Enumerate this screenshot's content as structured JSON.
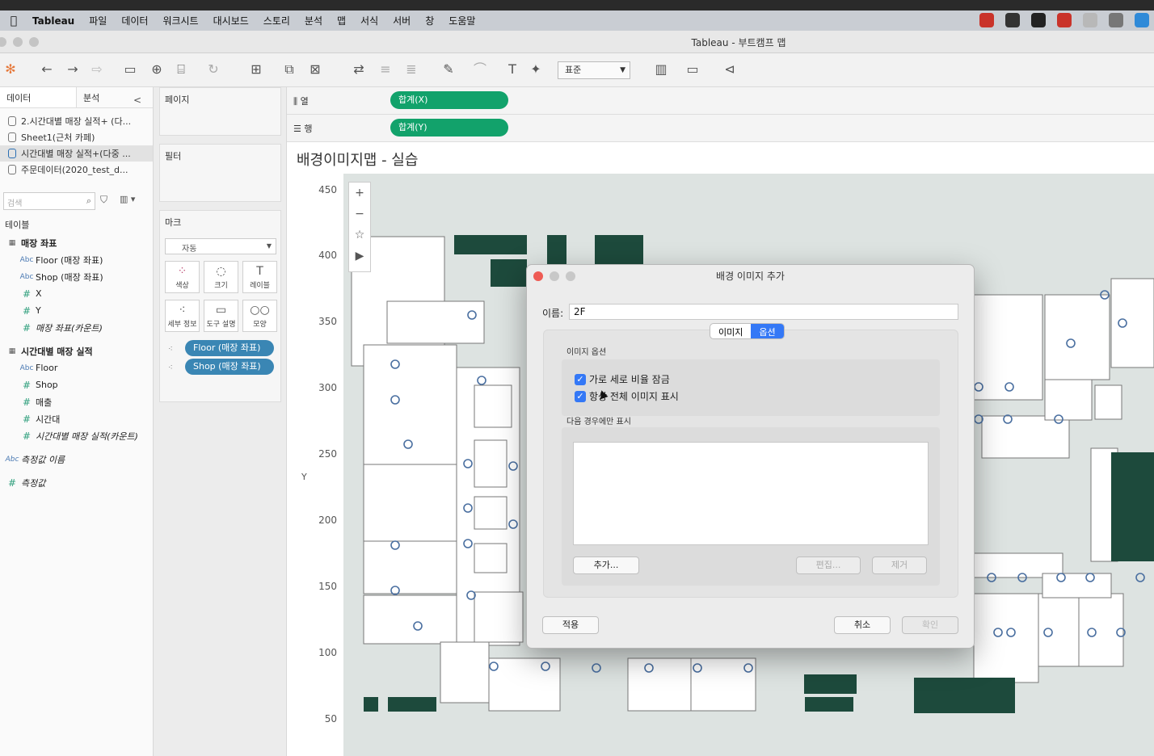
{
  "menubar": {
    "apple": "",
    "app": "Tableau",
    "items": [
      "파일",
      "데이터",
      "워크시트",
      "대시보드",
      "스토리",
      "분석",
      "맵",
      "서식",
      "서버",
      "창",
      "도움말"
    ],
    "tray_colors": [
      "#c9332a",
      "#333333",
      "#222222",
      "#c9332a",
      "#b8b8b8",
      "#777777",
      "#2f8ad8"
    ]
  },
  "window": {
    "title": "Tableau - 부트캠프 맵"
  },
  "toolbar": {
    "icons": [
      "tableau-logo-icon",
      "back-icon",
      "forward-icon",
      "redo-icon",
      "save-icon",
      "add-datasource-icon",
      "datasource-icon",
      "refresh-icon",
      "new-sheet-icon",
      "duplicate-sheet-icon",
      "clear-sheet-icon",
      "swap-icon",
      "sort-asc-icon",
      "sort-desc-icon",
      "highlight-icon",
      "group-icon",
      "label-icon",
      "pin-icon",
      "show-me-icon",
      "presentation-icon",
      "share-icon"
    ],
    "fit_value": "표준"
  },
  "datapane": {
    "tab_data": "데이터",
    "tab_analysis": "분석",
    "collapse": "<",
    "sources": [
      {
        "label": "2.시간대별 매장 실적+ (다..."
      },
      {
        "label": "Sheet1(근처 카페)"
      },
      {
        "label": "시간대별 매장 실적+(다중 ..."
      },
      {
        "label": "주문데이터(2020_test_d..."
      }
    ],
    "search_placeholder": "검색",
    "tables_label": "테이블",
    "fields": [
      {
        "type": "grp",
        "icon": "▦",
        "label": "매장 좌표",
        "level": 1
      },
      {
        "type": "dim",
        "icon": "Abc",
        "label": "Floor (매장 좌표)",
        "level": 2
      },
      {
        "type": "dim",
        "icon": "Abc",
        "label": "Shop (매장 좌표)",
        "level": 2
      },
      {
        "type": "meas",
        "icon": "#",
        "label": "X",
        "level": 2
      },
      {
        "type": "meas",
        "icon": "#",
        "label": "Y",
        "level": 2
      },
      {
        "type": "meas it",
        "icon": "#",
        "label": "매장 좌표(카운트)",
        "level": 2
      },
      {
        "type": "grp",
        "icon": "▦",
        "label": "시간대별 매장 실적",
        "level": 1
      },
      {
        "type": "dim",
        "icon": "Abc",
        "label": "Floor",
        "level": 2
      },
      {
        "type": "meas",
        "icon": "#",
        "label": "Shop",
        "level": 2
      },
      {
        "type": "meas",
        "icon": "#",
        "label": "매출",
        "level": 2
      },
      {
        "type": "meas",
        "icon": "#",
        "label": "시간대",
        "level": 2
      },
      {
        "type": "meas it",
        "icon": "#",
        "label": "시간대별 매장 실적(카운트)",
        "level": 2
      },
      {
        "type": "dim it",
        "icon": "Abc",
        "label": "측정값 이름",
        "level": 1
      },
      {
        "type": "meas it",
        "icon": "#",
        "label": "측정값",
        "level": 1
      }
    ]
  },
  "cards": {
    "pages": "페이지",
    "filters": "필터",
    "marks": "마크",
    "mark_type": "자동",
    "mark_buttons": [
      "색상",
      "크기",
      "레이블",
      "세부 정보",
      "도구 설명",
      "모양"
    ],
    "pills": [
      "Floor (매장 좌표)",
      "Shop (매장 좌표)"
    ]
  },
  "shelves": {
    "columns_label": "열",
    "rows_label": "행",
    "columns_pill": "합계(X)",
    "rows_pill": "합계(Y)"
  },
  "view": {
    "title": "배경이미지맵 - 실습",
    "y_axis_label": "Y",
    "y_ticks": [
      "450",
      "400",
      "350",
      "300",
      "250",
      "200",
      "150",
      "100",
      "50"
    ],
    "zoom": [
      "+",
      "−",
      "☆",
      "▶"
    ]
  },
  "dialog": {
    "title": "배경 이미지 추가",
    "name_label": "이름:",
    "name_value": "2F",
    "tab_image": "이미지",
    "tab_options": "옵션",
    "image_options": "이미지 옵션",
    "lock_aspect": "가로 세로 비율 잠금",
    "always_show": "항상 전체 이미지 표시",
    "show_only_when": "다음 경우에만 표시",
    "add": "추가...",
    "edit": "편집...",
    "remove": "제거",
    "apply": "적용",
    "cancel": "취소",
    "ok": "확인"
  }
}
